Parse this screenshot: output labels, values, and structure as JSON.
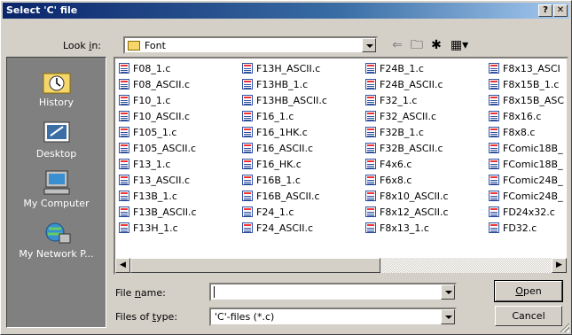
{
  "window": {
    "title": "Select 'C' file",
    "help_btn": "?",
    "close_btn": "✕"
  },
  "lookin": {
    "label_pre": "Look ",
    "label_u": "i",
    "label_post": "n:",
    "value": "Font"
  },
  "places": [
    {
      "label": "History",
      "icon": "history-icon"
    },
    {
      "label": "Desktop",
      "icon": "desktop-icon"
    },
    {
      "label": "My Computer",
      "icon": "my-computer-icon"
    },
    {
      "label": "My Network P...",
      "icon": "network-places-icon"
    }
  ],
  "files": {
    "col1": [
      "F08_1.c",
      "F08_ASCII.c",
      "F10_1.c",
      "F10_ASCII.c",
      "F105_1.c",
      "F105_ASCII.c",
      "F13_1.c",
      "F13_ASCII.c",
      "F13B_1.c",
      "F13B_ASCII.c",
      "F13H_1.c"
    ],
    "col2": [
      "F13H_ASCII.c",
      "F13HB_1.c",
      "F13HB_ASCII.c",
      "F16_1.c",
      "F16_1HK.c",
      "F16_ASCII.c",
      "F16_HK.c",
      "F16B_1.c",
      "F16B_ASCII.c",
      "F24_1.c",
      "F24_ASCII.c"
    ],
    "col3": [
      "F24B_1.c",
      "F24B_ASCII.c",
      "F32_1.c",
      "F32_ASCII.c",
      "F32B_1.c",
      "F32B_ASCII.c",
      "F4x6.c",
      "F6x8.c",
      "F8x10_ASCII.c",
      "F8x12_ASCII.c",
      "F8x13_1.c"
    ],
    "col4": [
      "F8x13_ASCI",
      "F8x15B_1.c",
      "F8x15B_ASC",
      "F8x16.c",
      "F8x8.c",
      "FComic18B_",
      "FComic18B_",
      "FComic24B_",
      "FComic24B_",
      "FD24x32.c",
      "FD32.c"
    ]
  },
  "filename": {
    "label_pre": "File ",
    "label_u": "n",
    "label_post": "ame:",
    "value": ""
  },
  "filetype": {
    "label_pre": "Files of ",
    "label_u": "t",
    "label_post": "ype:",
    "value": "'C'-files (*.c)"
  },
  "buttons": {
    "open_u": "O",
    "open_rest": "pen",
    "cancel": "Cancel"
  }
}
